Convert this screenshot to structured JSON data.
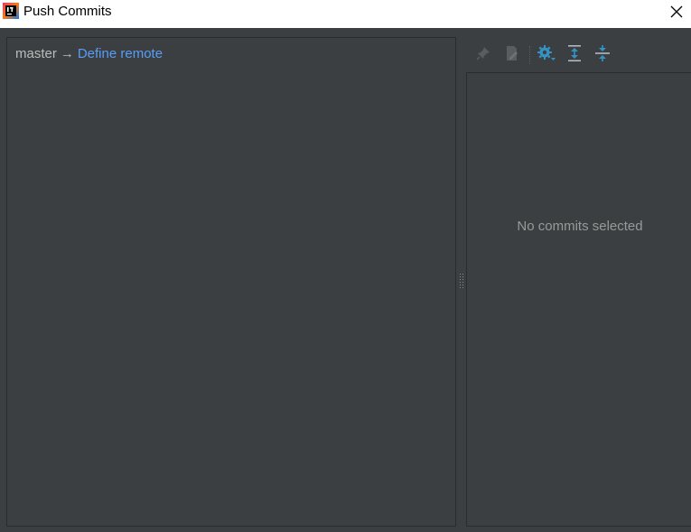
{
  "window": {
    "title": "Push Commits"
  },
  "branch": {
    "local": "master",
    "arrow": "→",
    "remote_link": "Define remote"
  },
  "details": {
    "empty_message": "No commits selected"
  },
  "toolbar": {
    "icons": [
      "pin-icon",
      "edit-icon",
      "settings-icon",
      "expand-all-icon",
      "collapse-all-icon"
    ]
  },
  "colors": {
    "background": "#3c3f41",
    "link": "#589df6",
    "accent_icon": "#3592c4"
  }
}
